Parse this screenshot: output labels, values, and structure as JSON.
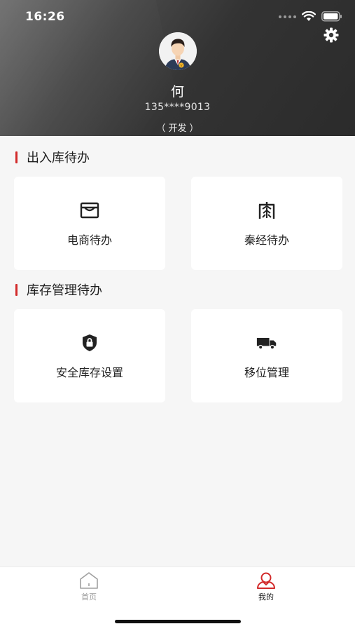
{
  "status_bar": {
    "time": "16:26"
  },
  "profile": {
    "name": "何",
    "phone": "135****9013",
    "role": "（ 开发 ）"
  },
  "sections": [
    {
      "title": "出入库待办",
      "cards": [
        {
          "label": "电商待办",
          "icon": "store-icon"
        },
        {
          "label": "秦经待办",
          "icon": "qin-icon"
        }
      ]
    },
    {
      "title": "库存管理待办",
      "cards": [
        {
          "label": "安全库存设置",
          "icon": "shield-lock-icon"
        },
        {
          "label": "移位管理",
          "icon": "truck-icon"
        }
      ]
    }
  ],
  "tabbar": {
    "items": [
      {
        "label": "首页",
        "icon": "home-icon",
        "active": false
      },
      {
        "label": "我的",
        "icon": "user-icon",
        "active": true
      }
    ]
  },
  "colors": {
    "accent": "#d22a2a",
    "header_dark": "#2b2b2b",
    "background": "#f6f6f6",
    "card": "#ffffff",
    "inactive_tab": "#9a9a9a"
  }
}
